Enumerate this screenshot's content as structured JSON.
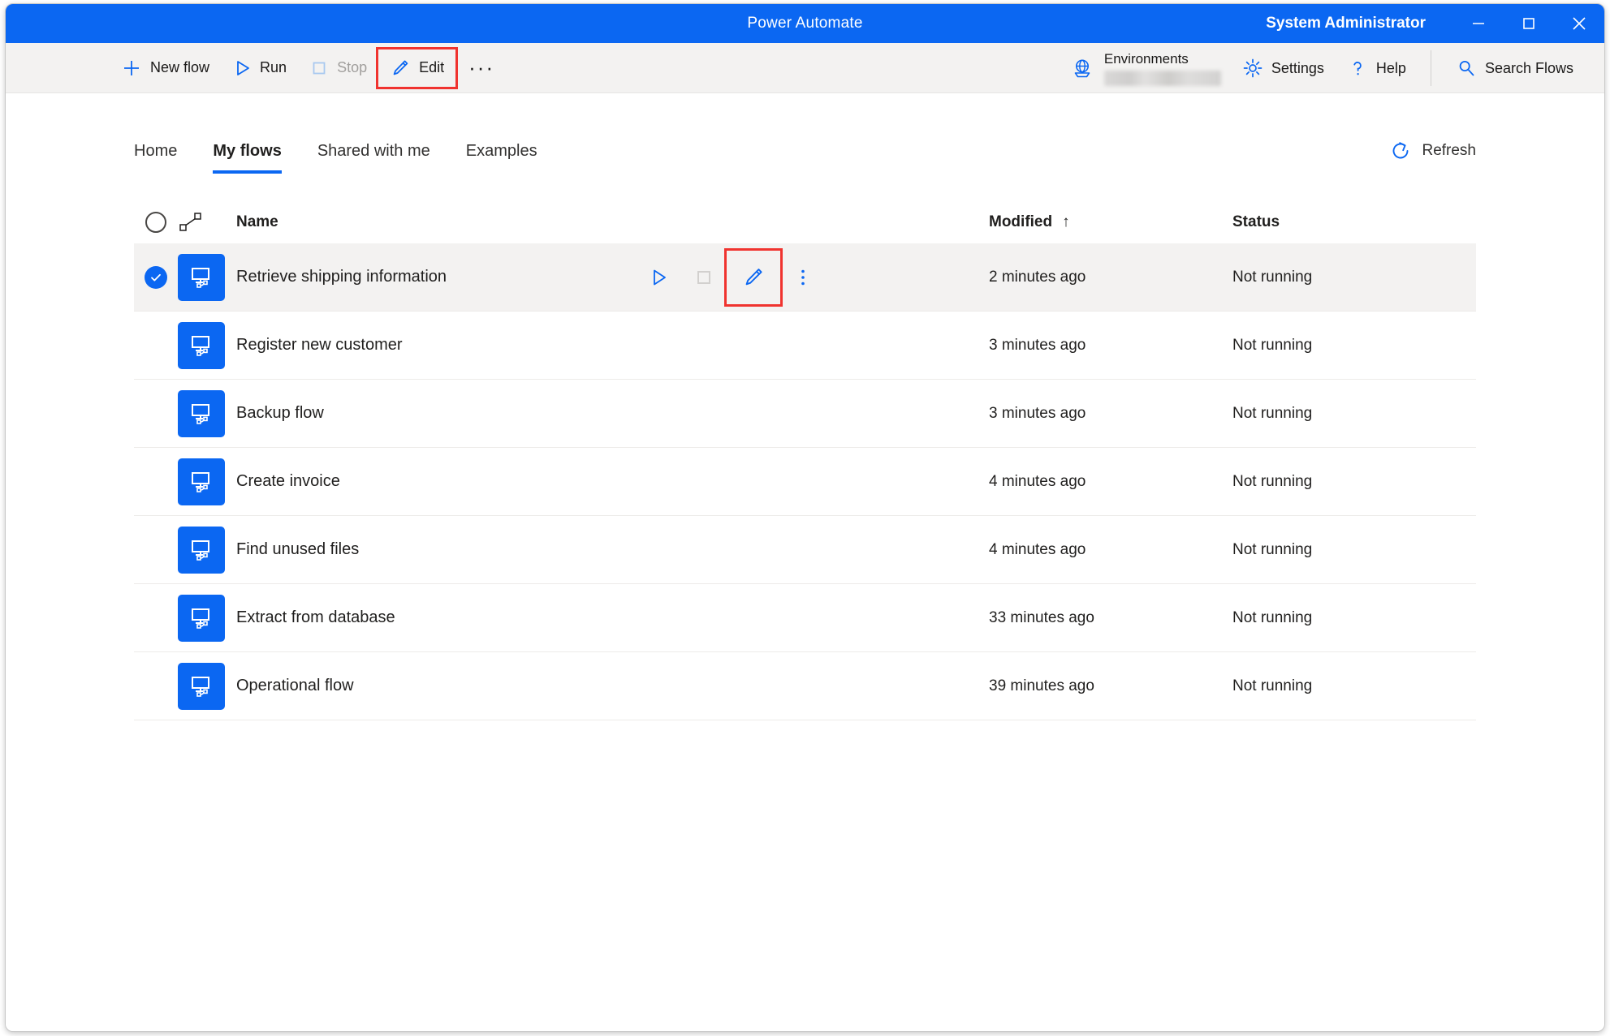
{
  "window": {
    "title": "Power Automate",
    "user": "System Administrator",
    "minimize_label": "Minimize",
    "maximize_label": "Maximize",
    "close_label": "Close"
  },
  "commandbar": {
    "new_flow": "New flow",
    "run": "Run",
    "stop": "Stop",
    "edit": "Edit",
    "more": "···",
    "environments_label": "Environments",
    "environments_value": "",
    "settings": "Settings",
    "help": "Help",
    "search": "Search Flows"
  },
  "tabs": [
    {
      "label": "Home",
      "active": false
    },
    {
      "label": "My flows",
      "active": true
    },
    {
      "label": "Shared with me",
      "active": false
    },
    {
      "label": "Examples",
      "active": false
    }
  ],
  "refresh": {
    "label": "Refresh"
  },
  "table": {
    "headers": {
      "name": "Name",
      "modified": "Modified",
      "status": "Status",
      "sort_arrow": "↑"
    },
    "rows": [
      {
        "name": "Retrieve shipping information",
        "modified": "2 minutes ago",
        "status": "Not running",
        "selected": true
      },
      {
        "name": "Register new customer",
        "modified": "3 minutes ago",
        "status": "Not running",
        "selected": false
      },
      {
        "name": "Backup flow",
        "modified": "3 minutes ago",
        "status": "Not running",
        "selected": false
      },
      {
        "name": "Create invoice",
        "modified": "4 minutes ago",
        "status": "Not running",
        "selected": false
      },
      {
        "name": "Find unused files",
        "modified": "4 minutes ago",
        "status": "Not running",
        "selected": false
      },
      {
        "name": "Extract from database",
        "modified": "33 minutes ago",
        "status": "Not running",
        "selected": false
      },
      {
        "name": "Operational flow",
        "modified": "39 minutes ago",
        "status": "Not running",
        "selected": false
      }
    ]
  },
  "colors": {
    "titlebar": "#0b67f2",
    "accent": "#0b67f2",
    "commandbar": "#f3f2f1",
    "highlight_box": "#f0332f",
    "row_selected": "#f3f2f1",
    "disabled_text": "#a19f9d"
  }
}
